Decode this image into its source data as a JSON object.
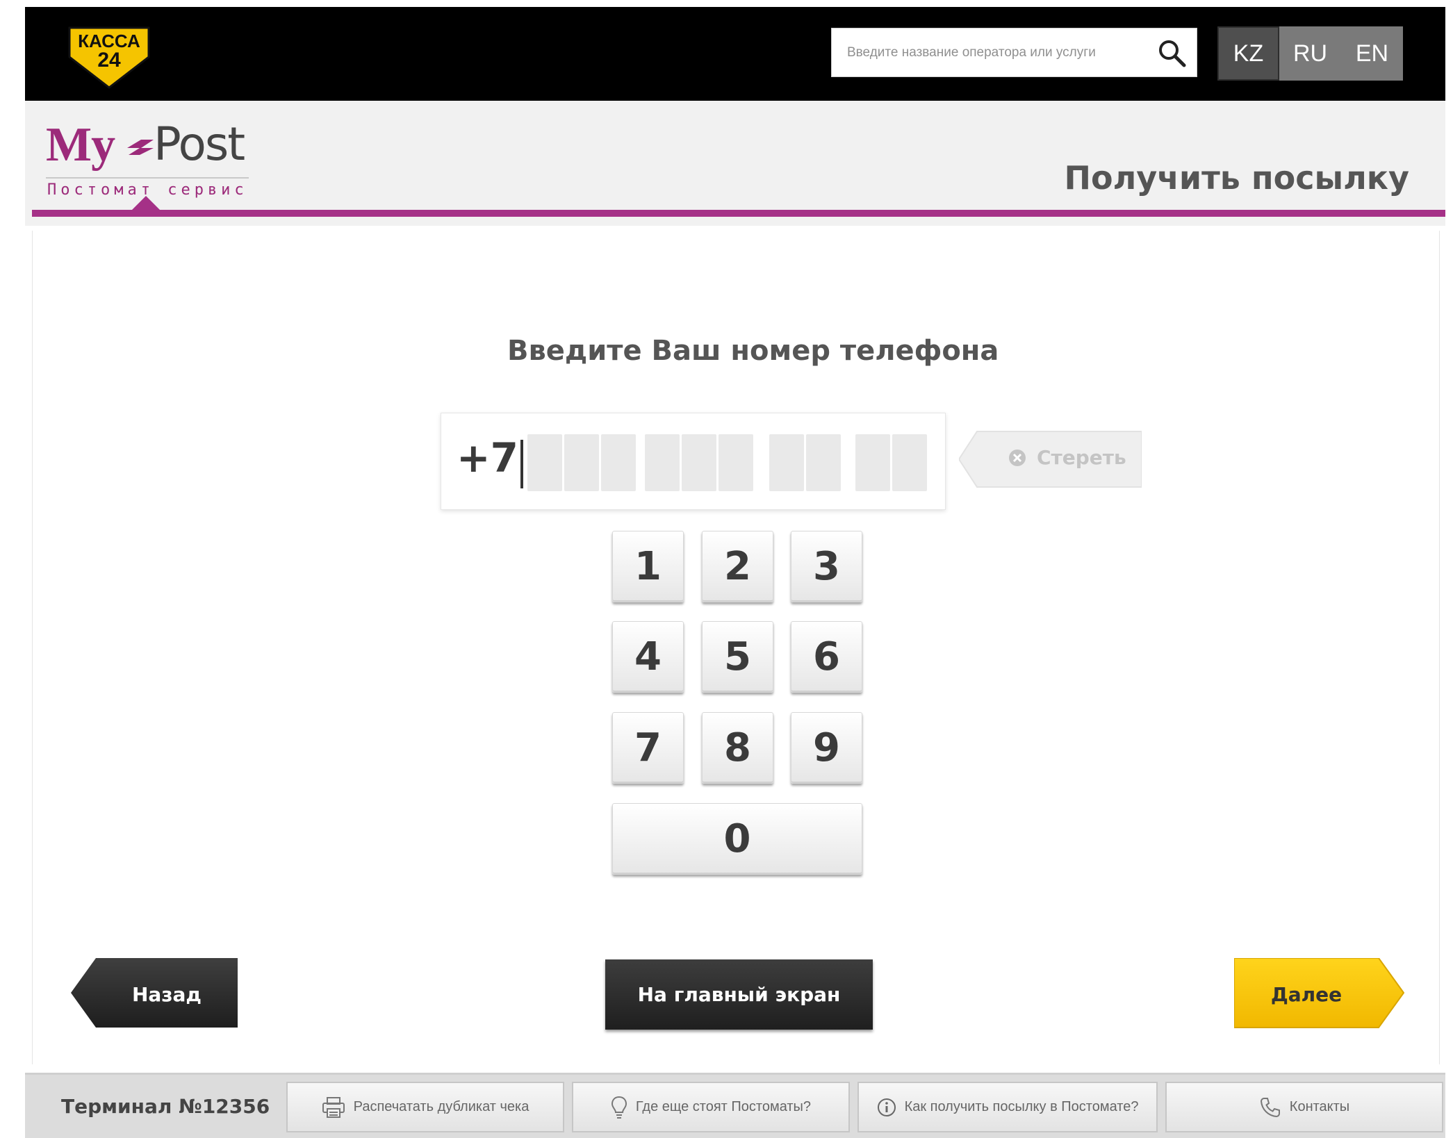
{
  "topbar": {
    "logo_line1": "КАССА",
    "logo_line2": "24",
    "search_placeholder": "Введите название оператора или услуги",
    "languages": [
      "KZ",
      "RU",
      "EN"
    ],
    "active_language": "KZ"
  },
  "header": {
    "brand_my": "My",
    "brand_post": "Post",
    "brand_subtitle": "Постомат сервис",
    "page_title": "Получить посылку"
  },
  "main": {
    "prompt": "Введите Ваш номер телефона",
    "phone_prefix": "+7",
    "erase_label": "Стереть",
    "keys": [
      "1",
      "2",
      "3",
      "4",
      "5",
      "6",
      "7",
      "8",
      "9",
      "0"
    ],
    "back_label": "Назад",
    "home_label": "На главный экран",
    "next_label": "Далее"
  },
  "footer": {
    "terminal": "Терминал №12356",
    "print_receipt": "Распечатать дубликат чека",
    "locations": "Где еще стоят Постоматы?",
    "how_to": "Как получить посылку в Постомате?",
    "contacts": "Контакты"
  },
  "colors": {
    "brand_purple": "#a53187",
    "accent_yellow": "#f7c400",
    "dark_button": "#262626"
  }
}
